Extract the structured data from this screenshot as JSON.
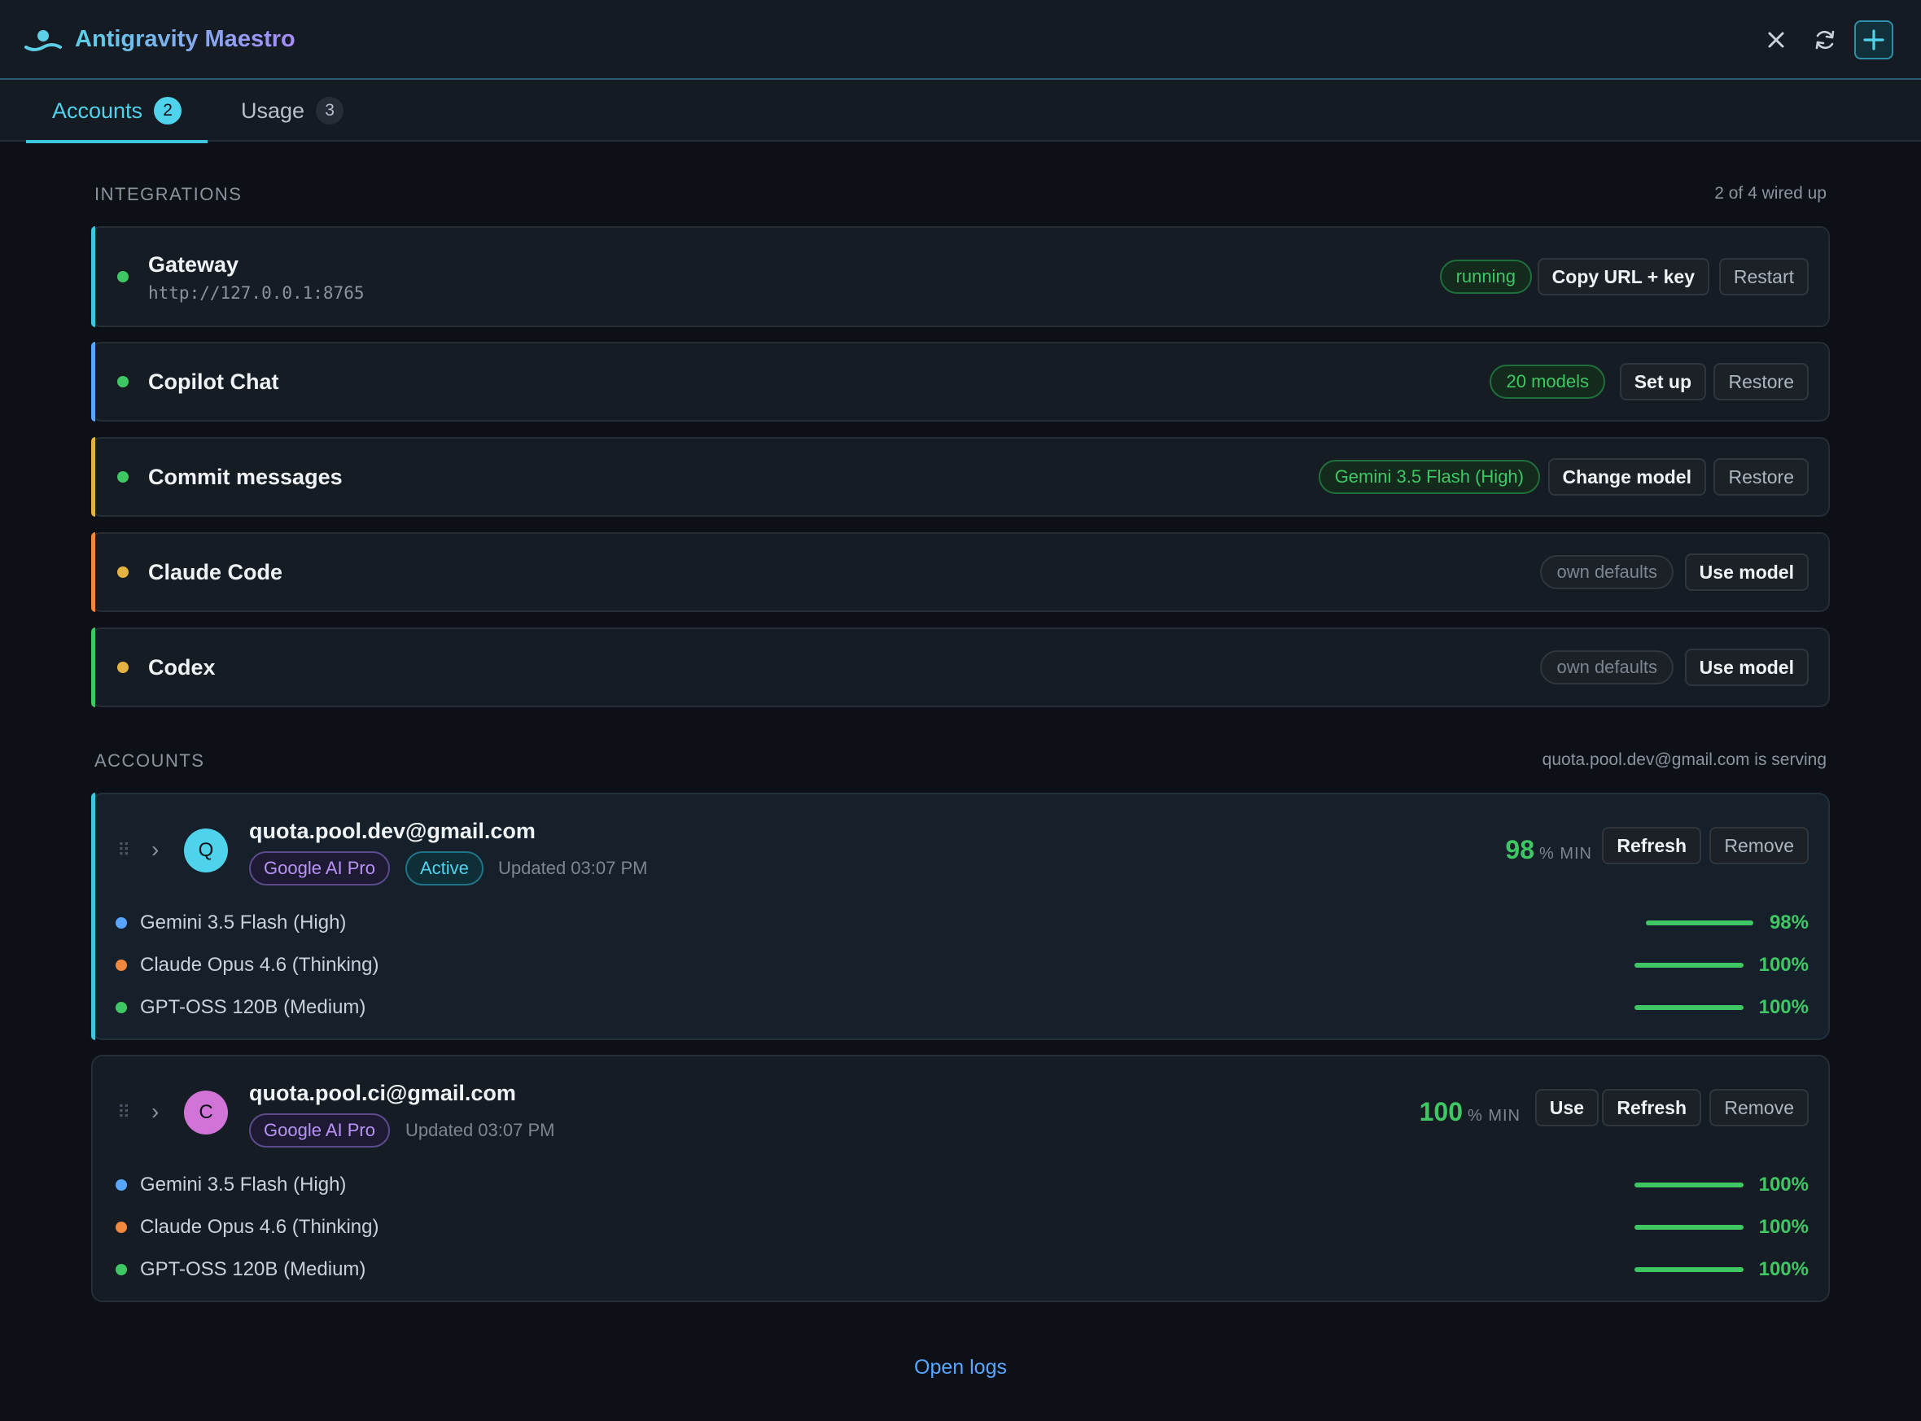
{
  "app": {
    "title": "Antigravity Maestro"
  },
  "header": {
    "close_icon": "close-icon",
    "refresh_icon": "refresh-icon",
    "add_icon": "plus-icon"
  },
  "tabs": [
    {
      "label": "Accounts",
      "count": "2",
      "active": true
    },
    {
      "label": "Usage",
      "count": "3",
      "active": false
    }
  ],
  "integrations": {
    "title": "INTEGRATIONS",
    "meta": "2 of 4 wired up",
    "items": [
      {
        "name": "Gateway",
        "sub": "http://127.0.0.1:8765",
        "status": "running",
        "buttons": [
          "Copy URL + key",
          "Restart"
        ],
        "accent": "#3ec6e0",
        "dot": "#3fc763"
      },
      {
        "name": "Copilot Chat",
        "status": "20 models",
        "buttons": [
          "Set up",
          "Restore"
        ],
        "accent": "#58a6ff",
        "dot": "#3fc763"
      },
      {
        "name": "Commit messages",
        "status": "Gemini 3.5 Flash (High)",
        "buttons": [
          "Change model",
          "Restore"
        ],
        "accent": "#e3b341",
        "dot": "#3fc763"
      },
      {
        "name": "Claude Code",
        "status": "own defaults",
        "buttons": [
          "Use model"
        ],
        "accent": "#f0883e",
        "dot": "#e3b341"
      },
      {
        "name": "Codex",
        "status": "own defaults",
        "buttons": [
          "Use model"
        ],
        "accent": "#3fc763",
        "dot": "#e3b341"
      }
    ]
  },
  "accounts": {
    "title": "ACCOUNTS",
    "meta": "quota.pool.dev@gmail.com is serving",
    "items": [
      {
        "email": "quota.pool.dev@gmail.com",
        "initial": "Q",
        "plan": "Google AI Pro",
        "active_label": "Active",
        "updated": "Updated 03:07 PM",
        "quota": "98",
        "quota_unit": "% MIN",
        "buttons": [
          "Refresh",
          "Remove"
        ],
        "models": [
          {
            "name": "Gemini 3.5 Flash (High)",
            "pct": "98%",
            "value": 0.98,
            "color": "#58a6ff"
          },
          {
            "name": "Claude Opus 4.6 (Thinking)",
            "pct": "100%",
            "value": 1.0,
            "color": "#f0883e"
          },
          {
            "name": "GPT-OSS 120B (Medium)",
            "pct": "100%",
            "value": 1.0,
            "color": "#3fc763"
          }
        ]
      },
      {
        "email": "quota.pool.ci@gmail.com",
        "initial": "C",
        "plan": "Google AI Pro",
        "updated": "Updated 03:07 PM",
        "quota": "100",
        "quota_unit": "% MIN",
        "buttons": [
          "Use",
          "Refresh",
          "Remove"
        ],
        "models": [
          {
            "name": "Gemini 3.5 Flash (High)",
            "pct": "100%",
            "value": 1.0,
            "color": "#58a6ff"
          },
          {
            "name": "Claude Opus 4.6 (Thinking)",
            "pct": "100%",
            "value": 1.0,
            "color": "#f0883e"
          },
          {
            "name": "GPT-OSS 120B (Medium)",
            "pct": "100%",
            "value": 1.0,
            "color": "#3fc763"
          }
        ]
      }
    ]
  },
  "footer": {
    "open_logs": "Open logs"
  }
}
